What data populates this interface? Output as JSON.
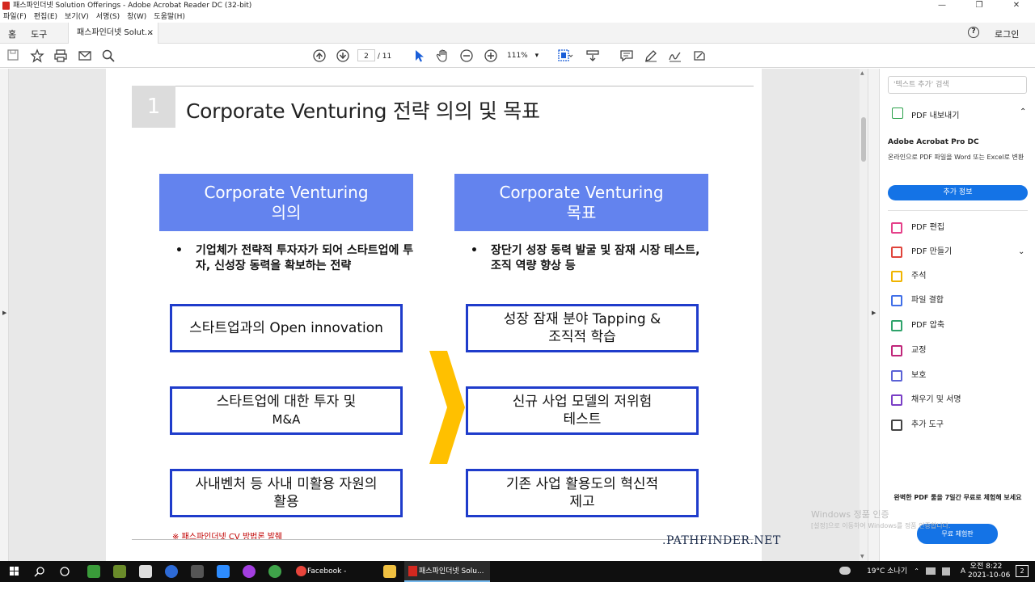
{
  "window": {
    "title": "패스파인더넷 Solution Offerings - Adobe Acrobat Reader DC (32-bit)",
    "controls": [
      "—",
      "❐",
      "✕"
    ]
  },
  "menu": [
    "파일(F)",
    "편집(E)",
    "보기(V)",
    "서명(S)",
    "창(W)",
    "도움말(H)"
  ],
  "tabs": {
    "home": "홈",
    "tools": "도구",
    "doc": "패스파인더넷 Solut...",
    "close": "×",
    "help": "?",
    "login": "로그인"
  },
  "toolbar": {
    "page_current": "2",
    "page_total": "/ 11",
    "zoom": "111%",
    "zoom_caret": "▾"
  },
  "slide": {
    "number": "1",
    "title": "Corporate Venturing 전략 의의 및 목표",
    "left_header": [
      "Corporate Venturing",
      "의의"
    ],
    "right_header": [
      "Corporate Venturing",
      "목표"
    ],
    "left_bullet": "기업체가 전략적 투자자가 되어 스타트업에 투자, 신성장 동력을 확보하는 전략",
    "right_bullet": "장단기 성장 동력 발굴 및 잠재 시장 테스트, 조직 역량 향상 등",
    "bullet_char": "•",
    "left_boxes": [
      {
        "line1": "스타트업과의 Open innovation",
        "line2": ""
      },
      {
        "line1": "스타트업에 대한 투자 및",
        "line2": "M&A"
      },
      {
        "line1": "사내벤처 등 사내 미활용 자원의",
        "line2": "활용"
      }
    ],
    "right_boxes": [
      {
        "line1": "성장 잠재 분야 Tapping &",
        "line2": "조직적 학습"
      },
      {
        "line1": "신규 사업 모델의 저위험",
        "line2": "테스트"
      },
      {
        "line1": "기존 사업 활용도의 혁신적",
        "line2": "제고"
      }
    ],
    "footnote": "※ 패스파인더넷 CV 방법론 발췌",
    "brand": ".PATHFINDER.NET",
    "chevron_color": "#ffc000"
  },
  "right_pane": {
    "search_placeholder": "'텍스트 추가' 검색",
    "export_label": "PDF 내보내기",
    "export_chevron": "⌃",
    "acrobat_title": "Adobe Acrobat Pro DC",
    "acrobat_desc": "온라인으로 PDF 파일을 Word 또는 Excel로 변환",
    "more_info": "추가 정보",
    "tools": [
      {
        "label": "PDF 편집",
        "icon": "edit-pdf-icon",
        "color": "#e5418a"
      },
      {
        "label": "PDF 만들기",
        "icon": "create-pdf-icon",
        "color": "#e0443b"
      },
      {
        "label": "주석",
        "icon": "comment-icon",
        "color": "#f0b400"
      },
      {
        "label": "파일 결합",
        "icon": "combine-files-icon",
        "color": "#3f6ee8"
      },
      {
        "label": "PDF 압축",
        "icon": "compress-pdf-icon",
        "color": "#2fa36b"
      },
      {
        "label": "교정",
        "icon": "redact-icon",
        "color": "#c0267a"
      },
      {
        "label": "보호",
        "icon": "protect-icon",
        "color": "#5b62d6"
      },
      {
        "label": "채우기 및 서명",
        "icon": "fill-sign-icon",
        "color": "#7a3fc6"
      },
      {
        "label": "추가 도구",
        "icon": "more-tools-icon",
        "color": "#444444"
      }
    ],
    "create_chevron": "⌄",
    "promo": "완벽한 PDF 툴을 7일간 무료로 체험해 보세요",
    "trial": "무료 체험판"
  },
  "watermark": {
    "line1": "Windows 정품 인증",
    "line2": "[설정]으로 이동하여 Windows를 정품 인증합니다."
  },
  "taskbar": {
    "apps": [
      "Facebook - Chrome",
      "패스파인더넷 Solu..."
    ],
    "weather": "19°C 소나기",
    "time": "오전 8:22",
    "date": "2021-10-06",
    "notif_count": "2"
  }
}
